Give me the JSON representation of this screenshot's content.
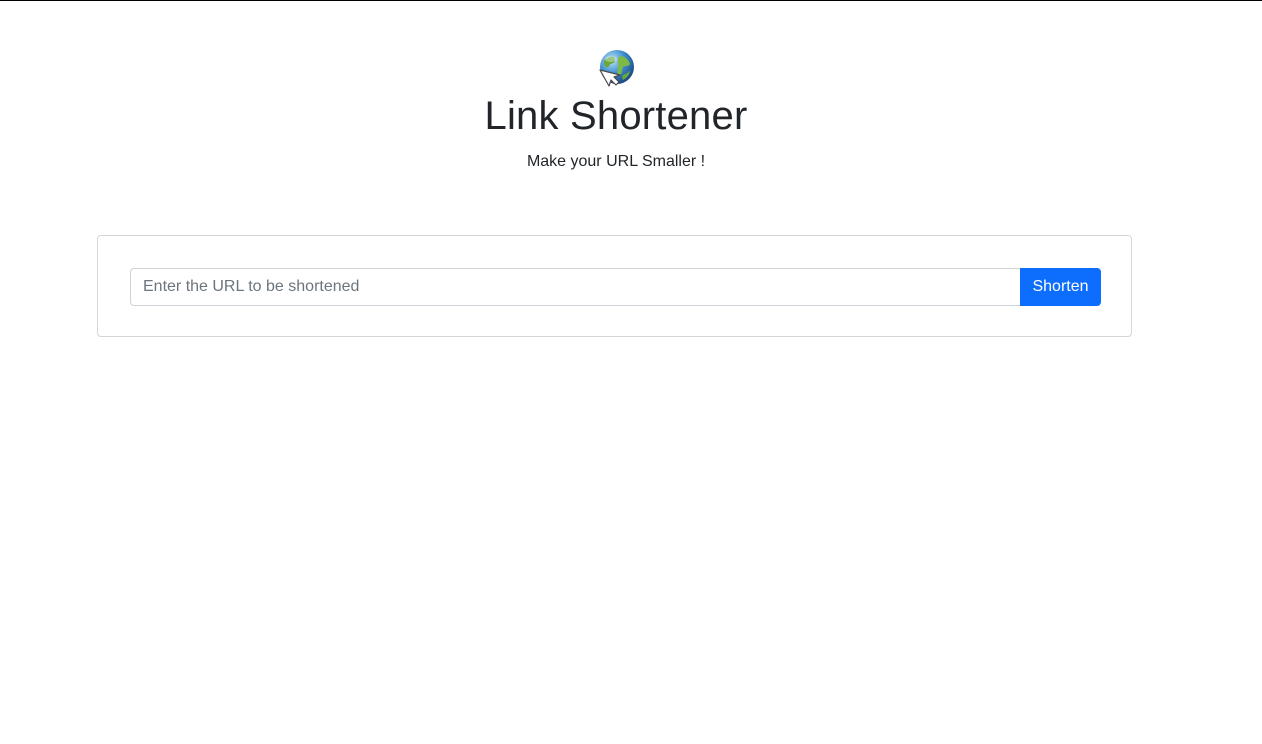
{
  "header": {
    "logo_icon": "globe-cursor-icon",
    "title": "Link Shortener",
    "subtitle": "Make your URL Smaller !"
  },
  "form": {
    "url_input": {
      "value": "",
      "placeholder": "Enter the URL to be shortened"
    },
    "submit_label": "Shorten"
  },
  "colors": {
    "accent": "#0d6efd",
    "text": "#212529",
    "border": "#d4d6d8",
    "background": "#ffffff"
  }
}
